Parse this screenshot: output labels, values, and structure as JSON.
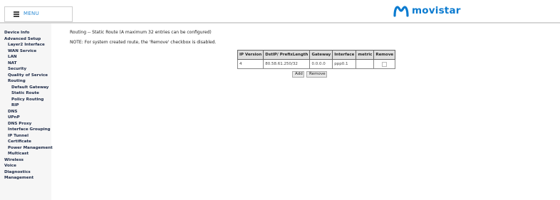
{
  "header": {
    "menu_label": "MENU",
    "brand": "movistar",
    "brand_color": "#0b7bd0",
    "menu_icon": "hamburger-icon"
  },
  "sidebar": {
    "items": [
      {
        "label": "Device Info"
      },
      {
        "label": "Advanced Setup"
      },
      {
        "label": "Layer2 Interface"
      },
      {
        "label": "WAN Service"
      },
      {
        "label": "LAN"
      },
      {
        "label": "NAT"
      },
      {
        "label": "Security"
      },
      {
        "label": "Quality of Service"
      },
      {
        "label": "Routing"
      },
      {
        "label": "Default Gateway"
      },
      {
        "label": "Static Route"
      },
      {
        "label": "Policy Routing"
      },
      {
        "label": "RIP"
      },
      {
        "label": "DNS"
      },
      {
        "label": "UPnP"
      },
      {
        "label": "DNS Proxy"
      },
      {
        "label": "Interface Grouping"
      },
      {
        "label": "IP Tunnel"
      },
      {
        "label": "Certificate"
      },
      {
        "label": "Power Management"
      },
      {
        "label": "Multicast"
      },
      {
        "label": "Wireless"
      },
      {
        "label": "Voice"
      },
      {
        "label": "Diagnostics"
      },
      {
        "label": "Management"
      }
    ]
  },
  "main": {
    "heading": "Routing -- Static Route (A maximum 32 entries can be configured)",
    "note": "NOTE: For system created route, the 'Remove' checkbox is disabled.",
    "table": {
      "headers": [
        "IP Version",
        "DstIP/ PrefixLength",
        "Gateway",
        "Interface",
        "metric",
        "Remove"
      ],
      "rows": [
        {
          "ip_version": "4",
          "dst": "80.58.61.250/32",
          "gateway": "0.0.0.0",
          "interface": "ppp0.1",
          "metric": "",
          "remove_disabled": true
        }
      ]
    },
    "add_label": "Add",
    "remove_label": "Remove"
  }
}
